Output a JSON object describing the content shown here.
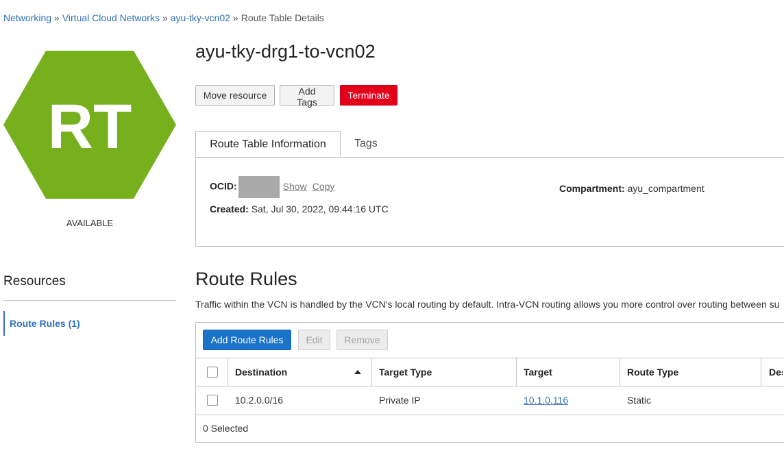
{
  "breadcrumb": {
    "items": [
      "Networking",
      "Virtual Cloud Networks",
      "ayu-tky-vcn02"
    ],
    "separator": "»",
    "current": "Route Table Details"
  },
  "resource_icon": {
    "text": "RT",
    "color": "#76b01c",
    "shape": "hexagon"
  },
  "status": "AVAILABLE",
  "title": "ayu-tky-drg1-to-vcn02",
  "actions": {
    "move": "Move resource",
    "add_tags": "Add Tags",
    "terminate": "Terminate"
  },
  "tabs": {
    "info": "Route Table Information",
    "tags": "Tags"
  },
  "info": {
    "ocid_label": "OCID:",
    "show": "Show",
    "copy": "Copy",
    "created_label": "Created:",
    "created_value": "Sat, Jul 30, 2022, 09:44:16 UTC",
    "compartment_label": "Compartment:",
    "compartment_value": "ayu_compartment"
  },
  "resources": {
    "title": "Resources",
    "item": "Route Rules (1)"
  },
  "route_rules": {
    "title": "Route Rules",
    "description": "Traffic within the VCN is handled by the VCN's local routing by default. Intra-VCN routing allows you more control over routing between su",
    "toolbar": {
      "add": "Add Route Rules",
      "edit": "Edit",
      "remove": "Remove"
    },
    "columns": [
      "Destination",
      "Target Type",
      "Target",
      "Route Type",
      "Des"
    ],
    "rows": [
      {
        "destination": "10.2.0.0/16",
        "target_type": "Private IP",
        "target": "10.1.0.116",
        "route_type": "Static"
      }
    ],
    "selected_count": "0 Selected"
  },
  "colors": {
    "accent": "#1a73c9",
    "link": "#2f70b6",
    "danger": "#e4001b"
  }
}
